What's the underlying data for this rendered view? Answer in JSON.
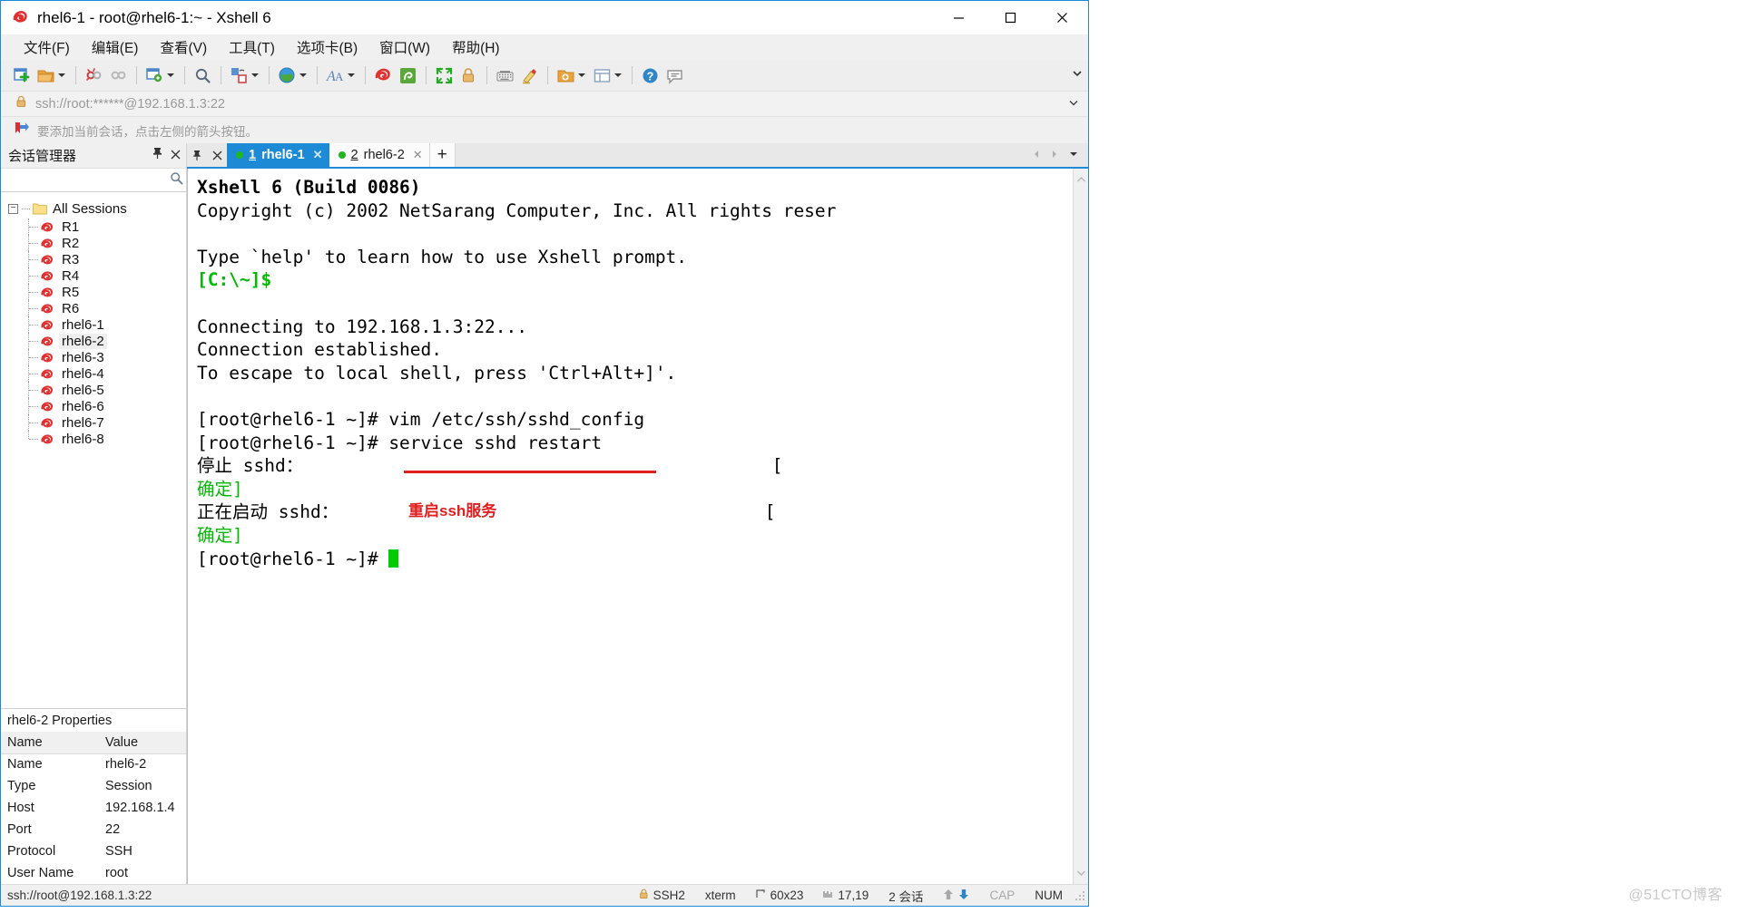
{
  "window": {
    "title": "rhel6-1 - root@rhel6-1:~ - Xshell 6",
    "app_icon": "xshell-icon",
    "minimize_label": "—",
    "maximize_label": "□",
    "close_label": "✕"
  },
  "menubar": {
    "items": [
      {
        "label": "文件(F)",
        "name": "menu-file"
      },
      {
        "label": "编辑(E)",
        "name": "menu-edit"
      },
      {
        "label": "查看(V)",
        "name": "menu-view"
      },
      {
        "label": "工具(T)",
        "name": "menu-tools"
      },
      {
        "label": "选项卡(B)",
        "name": "menu-tabs"
      },
      {
        "label": "窗口(W)",
        "name": "menu-window"
      },
      {
        "label": "帮助(H)",
        "name": "menu-help"
      }
    ]
  },
  "addressbar": {
    "lock_icon": "lock-icon",
    "value": "ssh://root:******@192.168.1.3:22",
    "dropdown_icon": "chevron-down-icon"
  },
  "hintbar": {
    "icon": "bookmark-arrow-icon",
    "text": "要添加当前会话，点击左侧的箭头按钮。"
  },
  "sidebar": {
    "title": "会话管理器",
    "pin_icon": "pin-icon",
    "close_icon": "close-icon",
    "search_placeholder": "",
    "search_value": "",
    "search_icon": "search-icon",
    "root_label": "All Sessions",
    "items": [
      {
        "label": "R1",
        "selected": false
      },
      {
        "label": "R2",
        "selected": false
      },
      {
        "label": "R3",
        "selected": false
      },
      {
        "label": "R4",
        "selected": false
      },
      {
        "label": "R5",
        "selected": false
      },
      {
        "label": "R6",
        "selected": false
      },
      {
        "label": "rhel6-1",
        "selected": false
      },
      {
        "label": "rhel6-2",
        "selected": true
      },
      {
        "label": "rhel6-3",
        "selected": false
      },
      {
        "label": "rhel6-4",
        "selected": false
      },
      {
        "label": "rhel6-5",
        "selected": false
      },
      {
        "label": "rhel6-6",
        "selected": false
      },
      {
        "label": "rhel6-7",
        "selected": false
      },
      {
        "label": "rhel6-8",
        "selected": false
      }
    ]
  },
  "properties": {
    "title": "rhel6-2 Properties",
    "headers": [
      "Name",
      "Value"
    ],
    "rows": [
      [
        "Name",
        "rhel6-2"
      ],
      [
        "Type",
        "Session"
      ],
      [
        "Host",
        "192.168.1.4"
      ],
      [
        "Port",
        "22"
      ],
      [
        "Protocol",
        "SSH"
      ],
      [
        "User Name",
        "root"
      ]
    ]
  },
  "tabs": {
    "pin_icon": "pin-icon",
    "close_icon": "close-icon",
    "add_label": "+",
    "prev_icon": "chevron-left-icon",
    "next_icon": "chevron-right-icon",
    "list_icon": "chevron-down-icon",
    "items": [
      {
        "num": "1",
        "label": "rhel6-1",
        "active": true
      },
      {
        "num": "2",
        "label": "rhel6-2",
        "active": false
      }
    ]
  },
  "terminal": {
    "lines": [
      {
        "text": "Xshell 6 (Build 0086)",
        "style": "bold"
      },
      {
        "text": "Copyright (c) 2002 NetSarang Computer, Inc. All rights reser",
        "style": "normal"
      },
      {
        "text": "",
        "style": "normal"
      },
      {
        "text": "Type `help' to learn how to use Xshell prompt.",
        "style": "normal"
      },
      {
        "text": "[C:\\~]$",
        "style": "green-bold"
      },
      {
        "text": "",
        "style": "normal"
      },
      {
        "text": "Connecting to 192.168.1.3:22...",
        "style": "normal"
      },
      {
        "text": "Connection established.",
        "style": "normal"
      },
      {
        "text": "To escape to local shell, press 'Ctrl+Alt+]'.",
        "style": "normal"
      },
      {
        "text": "",
        "style": "normal"
      },
      {
        "text": "[root@rhel6-1 ~]# vim /etc/ssh/sshd_config",
        "style": "normal"
      },
      {
        "text": "[root@rhel6-1 ~]# service sshd restart",
        "style": "normal"
      },
      {
        "text": "停止 sshd：                                            [",
        "style": "normal"
      },
      {
        "text": "确定]",
        "style": "green"
      },
      {
        "text": "正在启动 sshd：                                        [",
        "style": "normal"
      },
      {
        "text": "确定]",
        "style": "green"
      },
      {
        "text": "[root@rhel6-1 ~]# ",
        "style": "cursor"
      }
    ],
    "annotation": {
      "text": "重启ssh服务",
      "color": "#e02020"
    }
  },
  "statusbar": {
    "connection": "ssh://root@192.168.1.3:22",
    "lock_icon": "lock-icon",
    "protocol": "SSH2",
    "terminal_type": "xterm",
    "size_icon": "size-icon",
    "size": "60x23",
    "cursor_icon": "cursor-icon",
    "cursor": "17,19",
    "sessions": "2 会话",
    "up_icon": "arrow-up-icon",
    "down_icon": "arrow-down-icon",
    "cap": "CAP",
    "num": "NUM"
  },
  "watermark": "@51CTO博客",
  "colors": {
    "accent": "#1c8ad4",
    "green": "#00bb00",
    "annotation_red": "#e02020"
  }
}
